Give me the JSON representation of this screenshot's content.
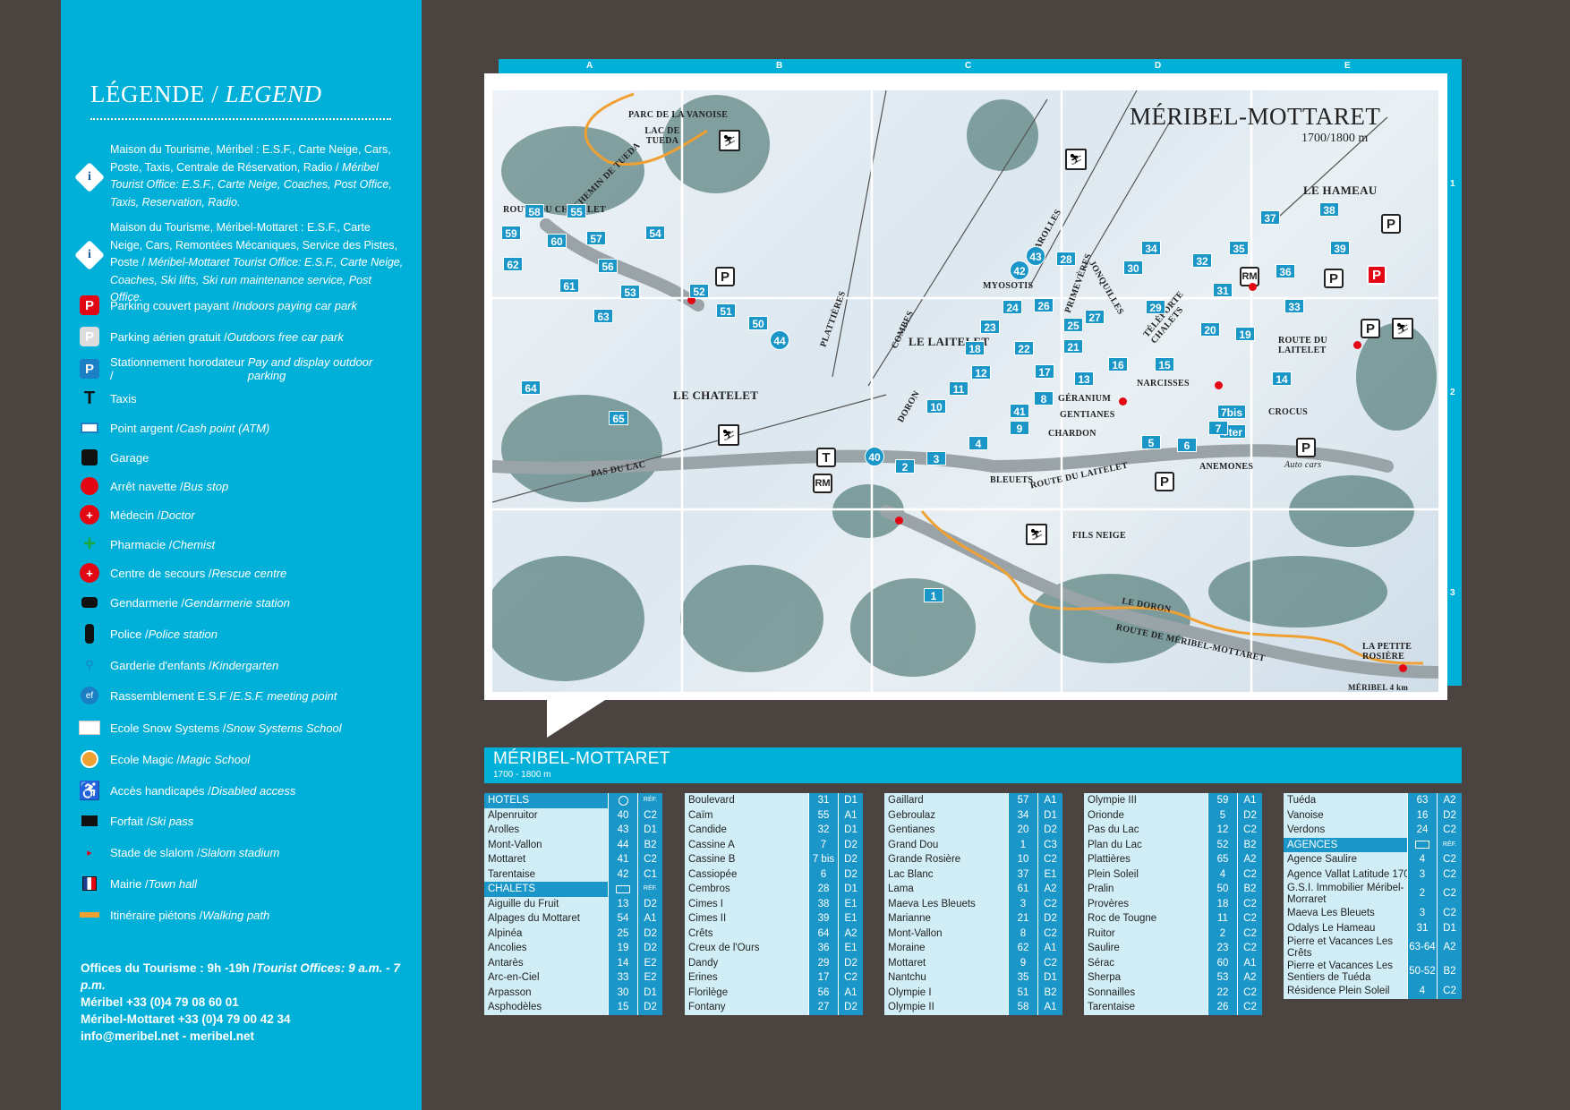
{
  "legend": {
    "title": "LÉGENDE /",
    "title_en": "LEGEND",
    "office1": {
      "fr": "Maison du Tourisme, Méribel : E.S.F., Carte Neige, Cars, Poste, Taxis, Centrale de Réservation, Radio /",
      "en": "Méribel Tourist Office: E.S.F., Carte Neige, Coaches, Post Office, Taxis, Reservation, Radio."
    },
    "office2": {
      "fr": "Maison du Tourisme, Méribel-Mottaret : E.S.F., Carte Neige, Cars, Remontées Mécaniques, Service des Pistes, Poste /",
      "en": "Méribel-Mottaret Tourist Office: E.S.F., Carte Neige, Coaches, Ski lifts, Ski run maintenance service, Post Office."
    },
    "items": [
      {
        "fr": "Parking couvert payant /",
        "en": "Indoors paying car park"
      },
      {
        "fr": "Parking aérien gratuit /",
        "en": "Outdoors free car park"
      },
      {
        "fr": "Stationnement horodateur /",
        "en": "Pay and display outdoor parking"
      },
      {
        "fr": "Taxis",
        "en": ""
      },
      {
        "fr": "Point argent /",
        "en": "Cash point (ATM)"
      },
      {
        "fr": "Garage",
        "en": ""
      },
      {
        "fr": "Arrêt navette /",
        "en": "Bus stop"
      },
      {
        "fr": "Médecin /",
        "en": "Doctor"
      },
      {
        "fr": "Pharmacie /",
        "en": "Chemist"
      },
      {
        "fr": "Centre de secours /",
        "en": "Rescue centre"
      },
      {
        "fr": "Gendarmerie /",
        "en": "Gendarmerie station"
      },
      {
        "fr": "Police /",
        "en": "Police station"
      },
      {
        "fr": "Garderie d'enfants /",
        "en": "Kindergarten"
      },
      {
        "fr": "Rassemblement E.S.F /",
        "en": "E.S.F. meeting point"
      },
      {
        "fr": "Ecole Snow Systems /",
        "en": "Snow Systems School"
      },
      {
        "fr": "Ecole Magic /",
        "en": "Magic School"
      },
      {
        "fr": "Accès handicapés /",
        "en": "Disabled access"
      },
      {
        "fr": "Forfait /",
        "en": "Ski pass"
      },
      {
        "fr": "Stade de slalom /",
        "en": "Slalom stadium"
      },
      {
        "fr": "Mairie /",
        "en": "Town hall"
      },
      {
        "fr": "Itinéraire piétons /",
        "en": "Walking path"
      }
    ],
    "icons": [
      "parking-covered-icon",
      "parking-free-icon",
      "parking-meter-icon",
      "taxi-icon",
      "atm-icon",
      "garage-icon",
      "bus-stop-icon",
      "doctor-icon",
      "pharmacy-icon",
      "rescue-icon",
      "gendarmerie-icon",
      "police-icon",
      "kindergarten-icon",
      "esf-icon",
      "snow-systems-icon",
      "magic-school-icon",
      "disabled-access-icon",
      "ski-pass-icon",
      "slalom-icon",
      "town-hall-icon",
      "walking-path-icon"
    ],
    "contact": {
      "hours_fr": "Offices du Tourisme : 9h -19h /",
      "hours_en": "Tourist Offices: 9 a.m. - 7 p.m.",
      "meribel": "Méribel +33 (0)4 79 08 60 01",
      "mottaret": "Méribel-Mottaret +33 (0)4 79 00 42 34",
      "web": "info@meribel.net - meribel.net"
    }
  },
  "map": {
    "title": "MÉRIBEL-MOTTARET",
    "altitude": "1700/1800 m",
    "columns": [
      "A",
      "B",
      "C",
      "D",
      "E"
    ],
    "rows": [
      "1",
      "2",
      "3"
    ],
    "places": {
      "parc": "PARC DE LA VANOISE",
      "lac": "LAC DE TUEDA",
      "chemin": "CHEMIN DE TUEDA",
      "route_chatelet": "ROUTE DU CHATELET",
      "le_hameau": "LE HAMEAU",
      "arolles": "AROLLES",
      "myosotis": "MYOSOTIS",
      "primeveres": "PRIMEVÈRES",
      "jonquilles": "JONQUILLES",
      "teleporte": "TÉLÉPORTE CHALETS",
      "combes": "COMBES",
      "le_laitelet": "LE LAITELET",
      "plattieres": "PLATTIÈRES",
      "le_chatelet": "LE CHATELET",
      "route_laitelet": "ROUTE DU LAITELET",
      "narcisses": "NARCISSES",
      "geranium": "GÉRANIUM",
      "gentianes": "GENTIANES",
      "crocus": "CROCUS",
      "doron": "DORON",
      "chardon": "CHARDON",
      "anemones": "ANEMONES",
      "auto_cars": "Auto cars",
      "pas_du_lac": "PAS DU LAC",
      "bleuets": "BLEUETS",
      "route_laitelet2": "ROUTE DU LAITELET",
      "fils_neige": "FILS NEIGE",
      "le_doron": "LE DORON",
      "route_mm": "ROUTE DE MÉRIBEL-MOTTARET",
      "petite_rosiere": "LA PETITE ROSIÈRE",
      "meribel_4km": "MÉRIBEL 4 km",
      "rm": "RM"
    },
    "numbers": [
      "58",
      "55",
      "59",
      "60",
      "57",
      "54",
      "62",
      "56",
      "61",
      "53",
      "63",
      "64",
      "65",
      "52",
      "51",
      "50",
      "44",
      "37",
      "38",
      "39",
      "36",
      "33",
      "34",
      "32",
      "35",
      "31",
      "43",
      "28",
      "30",
      "29",
      "24",
      "26",
      "25",
      "27",
      "23",
      "22",
      "21",
      "20",
      "19",
      "18",
      "17",
      "16",
      "15",
      "14",
      "13",
      "12",
      "11",
      "10",
      "9",
      "8",
      "7bis",
      "7ter",
      "7",
      "6",
      "5",
      "4",
      "3",
      "2",
      "1",
      "41",
      "42",
      "40"
    ]
  },
  "index": {
    "title": "MÉRIBEL-MOTTARET",
    "subtitle": "1700 - 1800 m",
    "ref_plan": "RÉF. PLAN",
    "columns": [
      [
        {
          "h": "HÔTELS",
          "icon": "dot"
        },
        {
          "n": "Alpenruitor",
          "a": "40",
          "b": "C2"
        },
        {
          "n": "Arolles",
          "a": "43",
          "b": "D1"
        },
        {
          "n": "Mont-Vallon",
          "a": "44",
          "b": "B2"
        },
        {
          "n": "Mottaret",
          "a": "41",
          "b": "C2"
        },
        {
          "n": "Tarentaise",
          "a": "42",
          "b": "C1"
        },
        {
          "h": "CHALETS",
          "icon": "sq"
        },
        {
          "n": "Aiguille du Fruit",
          "a": "13",
          "b": "D2"
        },
        {
          "n": "Alpages du Mottaret",
          "a": "54",
          "b": "A1"
        },
        {
          "n": "Alpinéa",
          "a": "25",
          "b": "D2"
        },
        {
          "n": "Ancolies",
          "a": "19",
          "b": "D2"
        },
        {
          "n": "Antarès",
          "a": "14",
          "b": "E2"
        },
        {
          "n": "Arc-en-Ciel",
          "a": "33",
          "b": "E2"
        },
        {
          "n": "Arpasson",
          "a": "30",
          "b": "D1"
        },
        {
          "n": "Asphodèles",
          "a": "15",
          "b": "D2"
        }
      ],
      [
        {
          "n": "Boulevard",
          "a": "31",
          "b": "D1"
        },
        {
          "n": "Caïm",
          "a": "55",
          "b": "A1"
        },
        {
          "n": "Candide",
          "a": "32",
          "b": "D1"
        },
        {
          "n": "Cassine A",
          "a": "7",
          "b": "D2"
        },
        {
          "n": "Cassine B",
          "a": "7 bis",
          "b": "D2"
        },
        {
          "n": "Cassiopée",
          "a": "6",
          "b": "D2"
        },
        {
          "n": "Cembros",
          "a": "28",
          "b": "D1"
        },
        {
          "n": "Cimes I",
          "a": "38",
          "b": "E1"
        },
        {
          "n": "Cimes II",
          "a": "39",
          "b": "E1"
        },
        {
          "n": "Crêts",
          "a": "64",
          "b": "A2"
        },
        {
          "n": "Creux de l'Ours",
          "a": "36",
          "b": "E1"
        },
        {
          "n": "Dandy",
          "a": "29",
          "b": "D2"
        },
        {
          "n": "Erines",
          "a": "17",
          "b": "C2"
        },
        {
          "n": "Florilège",
          "a": "56",
          "b": "A1"
        },
        {
          "n": "Fontany",
          "a": "27",
          "b": "D2"
        }
      ],
      [
        {
          "n": "Gaillard",
          "a": "57",
          "b": "A1"
        },
        {
          "n": "Gebroulaz",
          "a": "34",
          "b": "D1"
        },
        {
          "n": "Gentianes",
          "a": "20",
          "b": "D2"
        },
        {
          "n": "Grand Dou",
          "a": "1",
          "b": "C3"
        },
        {
          "n": "Grande Rosière",
          "a": "10",
          "b": "C2"
        },
        {
          "n": "Lac Blanc",
          "a": "37",
          "b": "E1"
        },
        {
          "n": "Lama",
          "a": "61",
          "b": "A2"
        },
        {
          "n": "Maeva Les Bleuets",
          "a": "3",
          "b": "C2"
        },
        {
          "n": "Marianne",
          "a": "21",
          "b": "D2"
        },
        {
          "n": "Mont-Vallon",
          "a": "8",
          "b": "C2"
        },
        {
          "n": "Moraine",
          "a": "62",
          "b": "A1"
        },
        {
          "n": "Mottaret",
          "a": "9",
          "b": "C2"
        },
        {
          "n": "Nantchu",
          "a": "35",
          "b": "D1"
        },
        {
          "n": "Olympie I",
          "a": "51",
          "b": "B2"
        },
        {
          "n": "Olympie II",
          "a": "58",
          "b": "A1"
        }
      ],
      [
        {
          "n": "Olympie III",
          "a": "59",
          "b": "A1"
        },
        {
          "n": "Orionde",
          "a": "5",
          "b": "D2"
        },
        {
          "n": "Pas du Lac",
          "a": "12",
          "b": "C2"
        },
        {
          "n": "Plan du Lac",
          "a": "52",
          "b": "B2"
        },
        {
          "n": "Plattières",
          "a": "65",
          "b": "A2"
        },
        {
          "n": "Plein Soleil",
          "a": "4",
          "b": "C2"
        },
        {
          "n": "Pralin",
          "a": "50",
          "b": "B2"
        },
        {
          "n": "Provères",
          "a": "18",
          "b": "C2"
        },
        {
          "n": "Roc de Tougne",
          "a": "11",
          "b": "C2"
        },
        {
          "n": "Ruitor",
          "a": "2",
          "b": "C2"
        },
        {
          "n": "Saulire",
          "a": "23",
          "b": "C2"
        },
        {
          "n": "Sérac",
          "a": "60",
          "b": "A1"
        },
        {
          "n": "Sherpa",
          "a": "53",
          "b": "A2"
        },
        {
          "n": "Sonnailles",
          "a": "22",
          "b": "C2"
        },
        {
          "n": "Tarentaise",
          "a": "26",
          "b": "C2"
        }
      ],
      [
        {
          "n": "Tuéda",
          "a": "63",
          "b": "A2"
        },
        {
          "n": "Vanoise",
          "a": "16",
          "b": "D2"
        },
        {
          "n": "Verdons",
          "a": "24",
          "b": "C2"
        },
        {
          "h": "AGENCES",
          "icon": "sq"
        },
        {
          "n": "Agence Saulire",
          "a": "4",
          "b": "C2"
        },
        {
          "n": "Agence Vallat Latitude 1700",
          "a": "3",
          "b": "C2"
        },
        {
          "n": "G.S.I. Immobilier Méribel-Morraret",
          "a": "2",
          "b": "C2",
          "tall": true
        },
        {
          "n": "Maeva Les Bleuets",
          "a": "3",
          "b": "C2"
        },
        {
          "n": "Odalys Le Hameau",
          "a": "31",
          "b": "D1"
        },
        {
          "n": "Pierre et Vacances Les Crêts",
          "a": "63-64",
          "b": "A2",
          "tall": true
        },
        {
          "n": "Pierre et Vacances Les Sentiers de Tuéda",
          "a": "50-52",
          "b": "B2",
          "tall": true
        },
        {
          "n": "Résidence Plein Soleil",
          "a": "4",
          "b": "C2"
        }
      ]
    ]
  }
}
